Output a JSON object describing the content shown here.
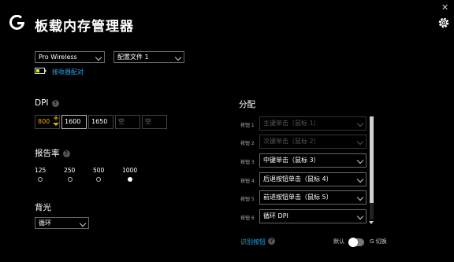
{
  "header": {
    "title": "板载内存管理器",
    "close": "✕"
  },
  "device": {
    "selected": "Pro Wireless"
  },
  "profile": {
    "selected": "配置文件 1"
  },
  "receiver": {
    "link": "接收器配对"
  },
  "dpi": {
    "title": "DPI",
    "help": "?",
    "values": [
      "800",
      "1600",
      "1650",
      "空",
      "空"
    ],
    "indicator_color": "#f2a900"
  },
  "report_rate": {
    "title": "报告率",
    "help": "?",
    "options": [
      "125",
      "250",
      "500",
      "1000"
    ],
    "selected": "1000"
  },
  "backlight": {
    "title": "背光",
    "selected": "循环"
  },
  "assign": {
    "title": "分配",
    "buttons": [
      {
        "label": "按钮 1",
        "value": "主键单击（鼠标 1）",
        "disabled": true
      },
      {
        "label": "按钮 2",
        "value": "次键单击（鼠标 2）",
        "disabled": true
      },
      {
        "label": "按钮 3",
        "value": "中键单击（鼠标 3）",
        "disabled": false
      },
      {
        "label": "按钮 4",
        "value": "后退按钮单击（鼠标 4）",
        "disabled": false
      },
      {
        "label": "按钮 5",
        "value": "前进按钮单击（鼠标 5）",
        "disabled": false
      },
      {
        "label": "按钮 6",
        "value": "循环 DPI",
        "disabled": false
      }
    ],
    "identify_link": "识别按钮",
    "identify_help": "?",
    "toggle_left": "默认",
    "toggle_right": "G 切换"
  },
  "colors": {
    "accent": "#2aa3e6",
    "battery": "#c8f000",
    "dpi_active": "#f2a900"
  }
}
